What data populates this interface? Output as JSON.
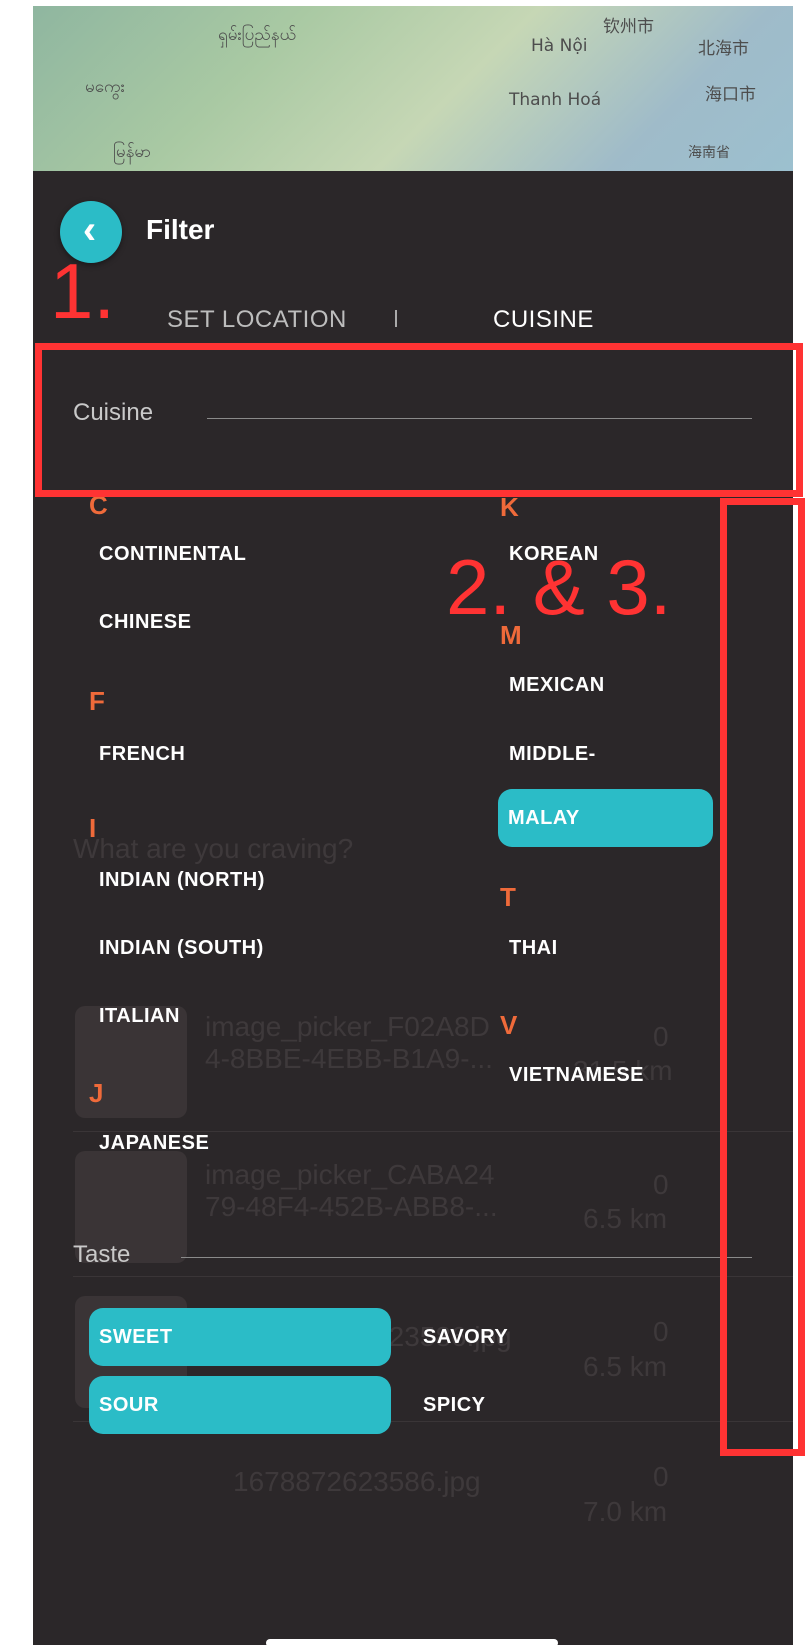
{
  "map_labels": [
    "ရှမ်းပြည်နယ်",
    "Hà Nội",
    "Thanh Hoá",
    "မကွေး",
    "မြန်မာ",
    "钦州市",
    "北海市",
    "海口市",
    "海南省"
  ],
  "header": {
    "title": "Filter"
  },
  "tabs": [
    {
      "label": "SET LOCATION",
      "active": false
    },
    {
      "label": "CUISINE",
      "active": true
    }
  ],
  "cuisine_section": {
    "label": "Cuisine"
  },
  "cuisine_left": [
    {
      "letter": "C",
      "items": [
        {
          "label": "CONTINENTAL",
          "selected": false
        },
        {
          "label": "CHINESE",
          "selected": false
        }
      ]
    },
    {
      "letter": "F",
      "items": [
        {
          "label": "FRENCH",
          "selected": false
        }
      ]
    },
    {
      "letter": "I",
      "items": [
        {
          "label": "INDIAN (NORTH)",
          "selected": false
        },
        {
          "label": "INDIAN (SOUTH)",
          "selected": false
        },
        {
          "label": "ITALIAN",
          "selected": false
        }
      ]
    },
    {
      "letter": "J",
      "items": [
        {
          "label": "JAPANESE",
          "selected": false
        }
      ]
    }
  ],
  "cuisine_right": [
    {
      "letter": "K",
      "items": [
        {
          "label": "KOREAN",
          "selected": false
        }
      ]
    },
    {
      "letter": "M",
      "items": [
        {
          "label": "MEXICAN",
          "selected": false
        },
        {
          "label": "MIDDLE-",
          "selected": false
        },
        {
          "label": "MALAY",
          "selected": true
        }
      ]
    },
    {
      "letter": "T",
      "items": [
        {
          "label": "THAI",
          "selected": false
        }
      ]
    },
    {
      "letter": "V",
      "items": [
        {
          "label": "VIETNAMESE",
          "selected": false
        }
      ]
    }
  ],
  "taste_section": {
    "label": "Taste",
    "items": [
      {
        "label": "SWEET",
        "selected": true
      },
      {
        "label": "SAVORY",
        "selected": false
      },
      {
        "label": "SOUR",
        "selected": true
      },
      {
        "label": "SPICY",
        "selected": false
      }
    ]
  },
  "background": {
    "heading": "What are you craving?",
    "rows": [
      {
        "name_line1": "image_picker_F02A8D",
        "name_line2": "4-8BBE-4EBB-B1A9-...",
        "count": "0",
        "distance": "31.5 km"
      },
      {
        "name_line1": "image_picker_CABA24",
        "name_line2": "79-48F4-452B-ABB8-...",
        "count": "0",
        "distance": "6.5 km"
      },
      {
        "name_line1": "...872623586.jpg",
        "name_line2": "",
        "count": "0",
        "distance": "6.5 km"
      },
      {
        "name_line1": "1678872623586.jpg",
        "name_line2": "",
        "count": "0",
        "distance": "7.0 km"
      }
    ]
  },
  "annotations": {
    "label1": "1.",
    "label2": "2. & 3."
  },
  "colors": {
    "accent": "#2bbcc7",
    "letter": "#ef6a3a",
    "annotation": "#ff3333",
    "panel": "#2b2729"
  }
}
